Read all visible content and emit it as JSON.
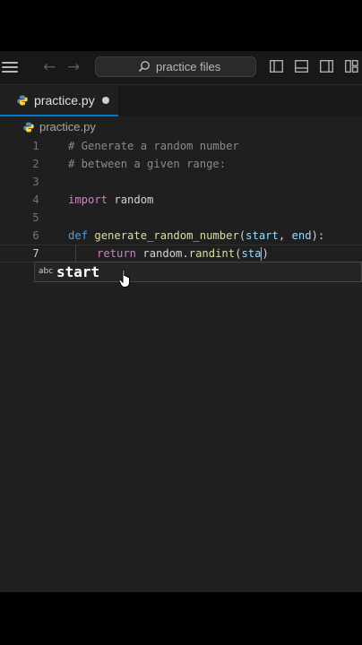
{
  "titlebar": {
    "search_placeholder": "practice files",
    "icons": [
      "menu-icon",
      "back-arrow-icon",
      "forward-arrow-icon",
      "search-icon",
      "toggle-sidebar-icon",
      "toggle-panel-icon",
      "toggle-secondary-sidebar-icon",
      "customize-layout-icon"
    ]
  },
  "tab": {
    "label": "practice.py",
    "modified": true
  },
  "breadcrumb": {
    "label": "practice.py"
  },
  "editor": {
    "active_line": 7,
    "lines": [
      {
        "number": "1",
        "text": "# Generate a random number"
      },
      {
        "number": "2",
        "text": "# between a given range:"
      },
      {
        "number": "3",
        "text": ""
      },
      {
        "number": "4",
        "text": "import random"
      },
      {
        "number": "5",
        "text": ""
      },
      {
        "number": "6",
        "text": "def generate_random_number(start, end):"
      },
      {
        "number": "7",
        "text": "    return random.randint(sta)"
      }
    ],
    "tokens": {
      "l4_kw": "import",
      "l4_rest": " random",
      "l6_kw": "def",
      "l6_fn": "generate_random_number",
      "l6_p1": "(",
      "l6_start": "start",
      "l6_comma": ", ",
      "l6_end": "end",
      "l6_close": "):",
      "l7_kw": "return",
      "l7_mod": " random.",
      "l7_fn": "randint",
      "l7_open": "(",
      "l7_arg": "sta",
      "l7_close": ")"
    }
  },
  "suggestion": {
    "kind": "abc",
    "label": "start"
  },
  "colors": {
    "accent": "#0078d4",
    "background": "#1f1f1f",
    "keyword": "#c586c0",
    "function": "#dcdcaa",
    "parameter": "#9cdcfe"
  }
}
